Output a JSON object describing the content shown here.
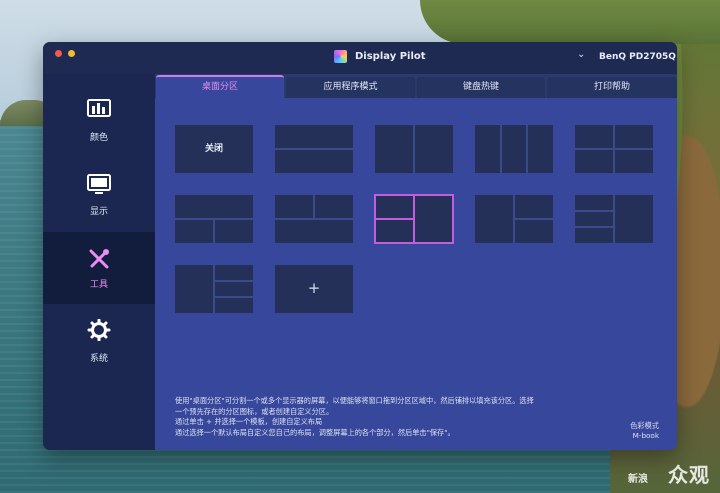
{
  "window": {
    "app_title": "Display Pilot",
    "monitor_name": "BenQ PD2705Q",
    "dropdown_glyph": "⌄"
  },
  "sidebar": {
    "items": [
      {
        "label": "颜色",
        "icon": "color-bars-icon"
      },
      {
        "label": "显示",
        "icon": "monitor-icon"
      },
      {
        "label": "工具",
        "icon": "tools-icon",
        "active": true
      },
      {
        "label": "系统",
        "icon": "gear-icon"
      }
    ]
  },
  "tabs": [
    {
      "label": "桌面分区",
      "active": true
    },
    {
      "label": "应用程序模式"
    },
    {
      "label": "键盘热键"
    },
    {
      "label": "打印帮助"
    }
  ],
  "layouts": {
    "off_label": "关闭",
    "add_label": "+"
  },
  "help": {
    "lines": [
      "使用\"桌面分区\"可分割一个或多个显示器的屏幕，以便能够将窗口拖到分区区域中，然后铺排以填充该分区。选择",
      "一个预先存在的分区图标，或者创建自定义分区。",
      "通过单击 + 并选择一个模板，创建自定义布局",
      "通过选择一个默认布局自定义您自己的布局，调整屏幕上的各个部分，然后单击\"保存\"。"
    ]
  },
  "color_mode": {
    "label": "色彩模式",
    "value": "M-book"
  },
  "watermark": {
    "text": "众观",
    "small": "新浪"
  },
  "colors": {
    "accent": "#c35de0",
    "active_text": "#e98ef0",
    "panel": "#37479c",
    "sidebar": "#1b2750",
    "tile": "#243058"
  }
}
